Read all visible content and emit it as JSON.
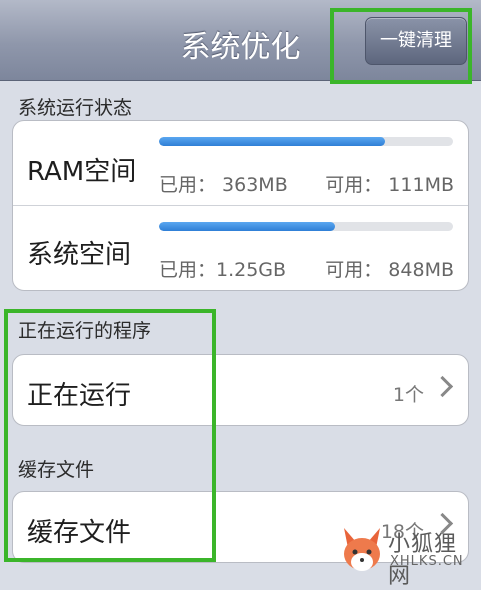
{
  "navbar": {
    "title": "系统优化",
    "clean_label": "一键清理"
  },
  "status_section": {
    "label": "系统运行状态",
    "rows": [
      {
        "title": "RAM空间",
        "used": "已用： 363MB",
        "available": "可用： 111MB",
        "usage_fraction": 0.77
      },
      {
        "title": "系统空间",
        "used": "已用：1.25GB",
        "available": "可用： 848MB",
        "usage_fraction": 0.6
      }
    ]
  },
  "running_section": {
    "label": "正在运行的程序",
    "item_title": "正在运行",
    "count": "1个"
  },
  "cache_section": {
    "label": "缓存文件",
    "item_title": "缓存文件",
    "count": "18个"
  },
  "watermark": {
    "text": "小狐狸网",
    "domain": "XHLKS.CN"
  },
  "colors": {
    "highlight": "#3bb52a",
    "progress": "#2f7fd6"
  }
}
